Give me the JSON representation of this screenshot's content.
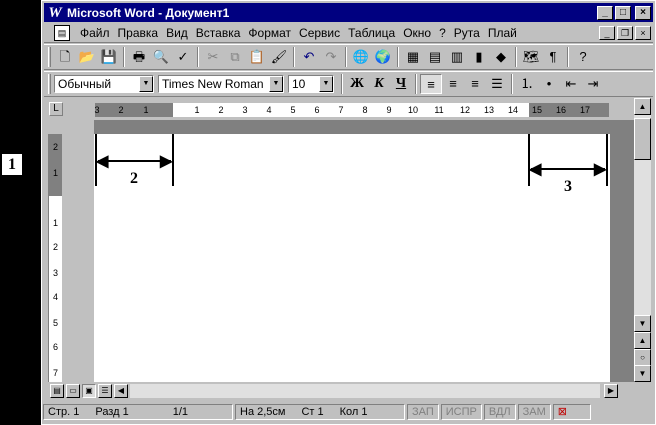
{
  "annotations": {
    "one": "1",
    "two": "2",
    "three": "3"
  },
  "window": {
    "title": "Microsoft Word - Документ1",
    "app_glyph": "W"
  },
  "title_buttons": {
    "minimize": "_",
    "maximize": "□",
    "close": "×"
  },
  "menu": {
    "items": [
      "Файл",
      "Правка",
      "Вид",
      "Вставка",
      "Формат",
      "Сервис",
      "Таблица",
      "Окно",
      "?",
      "Рута",
      "Плай"
    ]
  },
  "doc_buttons": {
    "minimize": "_",
    "restore": "❐",
    "close": "×"
  },
  "toolbar_standard": {
    "icons": [
      "new-doc-icon",
      "open-icon",
      "save-icon",
      "print-icon",
      "print-preview-icon",
      "spelling-icon",
      "cut-icon",
      "copy-icon",
      "paste-icon",
      "format-painter-icon",
      "undo-icon",
      "redo-icon",
      "hyperlink-icon",
      "web-toolbar-icon",
      "tables-borders-icon",
      "insert-table-icon",
      "insert-excel-icon",
      "columns-icon",
      "drawing-icon",
      "document-map-icon",
      "show-formatting-icon",
      "help-icon"
    ]
  },
  "toolbar_format": {
    "style": "Обычный",
    "font": "Times New Roman",
    "size": "10",
    "bold": "Ж",
    "italic": "К",
    "underline": "Ч"
  },
  "ruler": {
    "h_numbers": [
      "3",
      "2",
      "1",
      "1",
      "2",
      "3",
      "4",
      "5",
      "6",
      "7",
      "8",
      "9",
      "10",
      "11",
      "12",
      "13",
      "14",
      "15",
      "16",
      "17"
    ],
    "v_numbers": [
      "2",
      "1",
      "1",
      "2",
      "3",
      "4",
      "5",
      "6",
      "7"
    ]
  },
  "statusbar": {
    "page": "Стр. 1",
    "section": "Разд 1",
    "pages": "1/1",
    "at": "На 2,5см",
    "line": "Ст 1",
    "col": "Кол 1",
    "rec": "ЗАП",
    "trk": "ИСПР",
    "ext": "ВДЛ",
    "ovr": "ЗАМ"
  },
  "colors": {
    "titlebar": "#000080",
    "chrome": "#c0c0c0",
    "page": "#ffffff",
    "backdrop": "#000000"
  }
}
